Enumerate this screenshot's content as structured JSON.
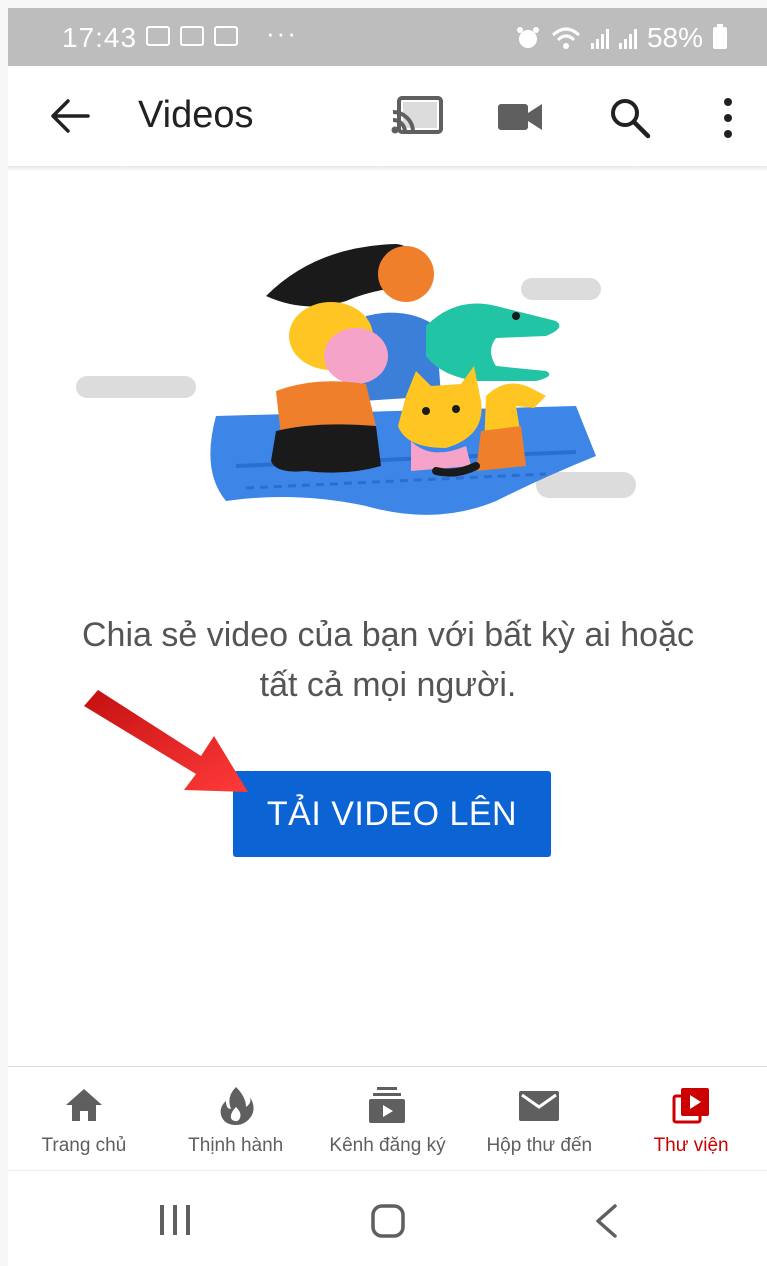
{
  "status_bar": {
    "time": "17:43",
    "dots": "···",
    "battery": "58%"
  },
  "app_bar": {
    "title": "Videos",
    "icons": [
      "arrow-back-icon",
      "cast-icon",
      "video-camera-icon",
      "search-icon",
      "more-vert-icon"
    ]
  },
  "content": {
    "message": "Chia sẻ video của bạn với bất kỳ ai hoặc tất cả mọi người.",
    "upload_button": "TẢI VIDEO LÊN"
  },
  "bottom_nav": {
    "items": [
      {
        "label": "Trang chủ",
        "icon": "home-icon",
        "active": false
      },
      {
        "label": "Thịnh hành",
        "icon": "trending-flame-icon",
        "active": false
      },
      {
        "label": "Kênh đăng ký",
        "icon": "subscriptions-icon",
        "active": false
      },
      {
        "label": "Hộp thư đến",
        "icon": "inbox-mail-icon",
        "active": false
      },
      {
        "label": "Thư viện",
        "icon": "library-icon",
        "active": true
      }
    ]
  },
  "colors": {
    "primary_button": "#0b63d4",
    "active_tab": "#cc0000",
    "annotation_arrow": "#e02020",
    "status_bar": "#bdbdbd"
  }
}
